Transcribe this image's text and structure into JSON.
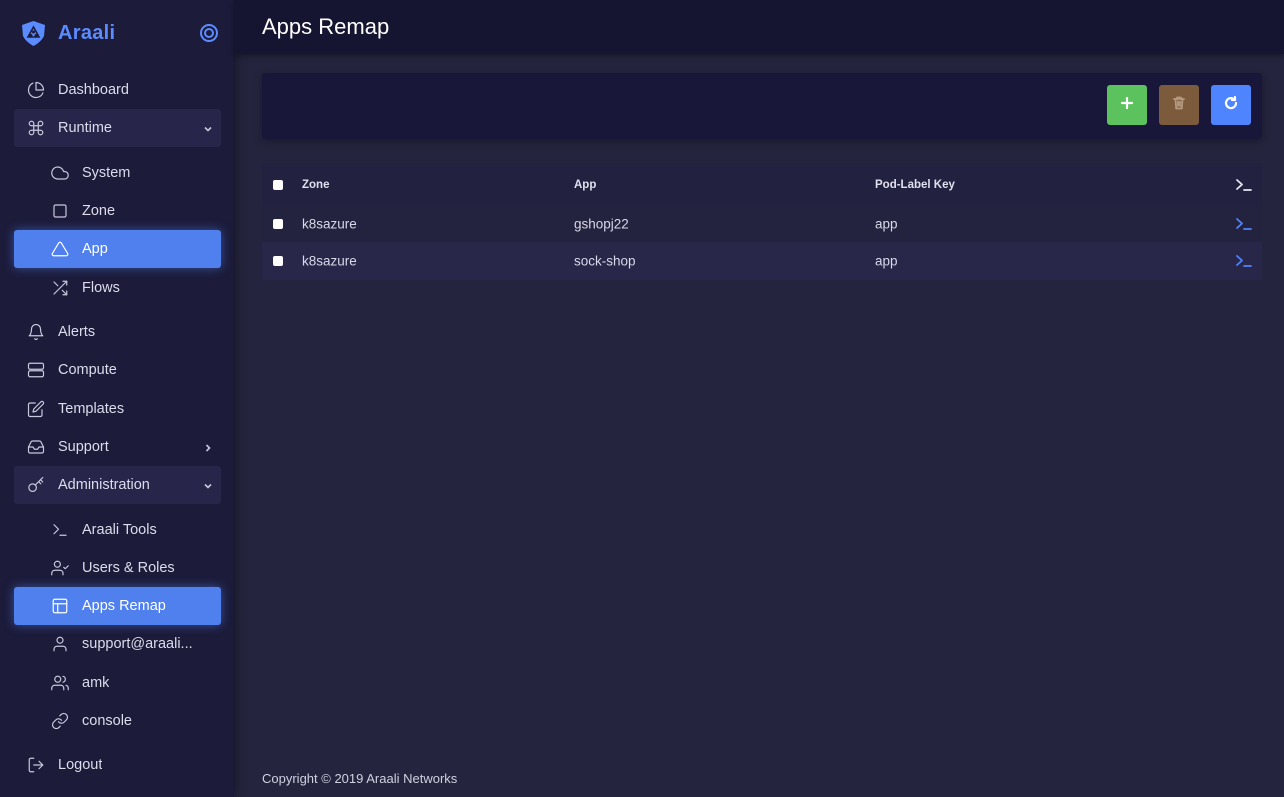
{
  "brand": {
    "name": "Araali"
  },
  "sidebar": {
    "items": [
      {
        "label": "Dashboard",
        "icon": "pie-chart-icon"
      },
      {
        "label": "Runtime",
        "icon": "command-icon",
        "expanded": true
      },
      {
        "label": "System",
        "icon": "cloud-icon"
      },
      {
        "label": "Zone",
        "icon": "square-icon"
      },
      {
        "label": "App",
        "icon": "triangle-icon",
        "active": true
      },
      {
        "label": "Flows",
        "icon": "shuffle-icon"
      },
      {
        "label": "Alerts",
        "icon": "bell-icon"
      },
      {
        "label": "Compute",
        "icon": "server-icon"
      },
      {
        "label": "Templates",
        "icon": "edit-icon"
      },
      {
        "label": "Support",
        "icon": "inbox-icon",
        "expanded": false
      },
      {
        "label": "Administration",
        "icon": "key-icon",
        "expanded": true
      },
      {
        "label": "Araali Tools",
        "icon": "terminal-icon"
      },
      {
        "label": "Users & Roles",
        "icon": "user-check-icon"
      },
      {
        "label": "Apps Remap",
        "icon": "layout-icon",
        "active": true
      },
      {
        "label": "support@araali...",
        "icon": "user-icon"
      },
      {
        "label": "amk",
        "icon": "users-icon"
      },
      {
        "label": "console",
        "icon": "link-icon"
      },
      {
        "label": "Logout",
        "icon": "logout-icon"
      }
    ]
  },
  "header": {
    "title": "Apps Remap"
  },
  "toolbar": {
    "add_icon": "plus-icon",
    "delete_icon": "trash-icon",
    "refresh_icon": "refresh-icon"
  },
  "table": {
    "columns": [
      "Zone",
      "App",
      "Pod-Label Key"
    ],
    "rows": [
      {
        "zone": "k8sazure",
        "app": "gshopj22",
        "key": "app"
      },
      {
        "zone": "k8sazure",
        "app": "sock-shop",
        "key": "app"
      }
    ]
  },
  "footer": {
    "text": "Copyright © 2019 Araali Networks"
  },
  "colors": {
    "accent": "#4f80ee",
    "brand": "#5b8cff",
    "add": "#5cc25e",
    "delete": "#7c5b3d",
    "refresh": "#4f84ff"
  }
}
